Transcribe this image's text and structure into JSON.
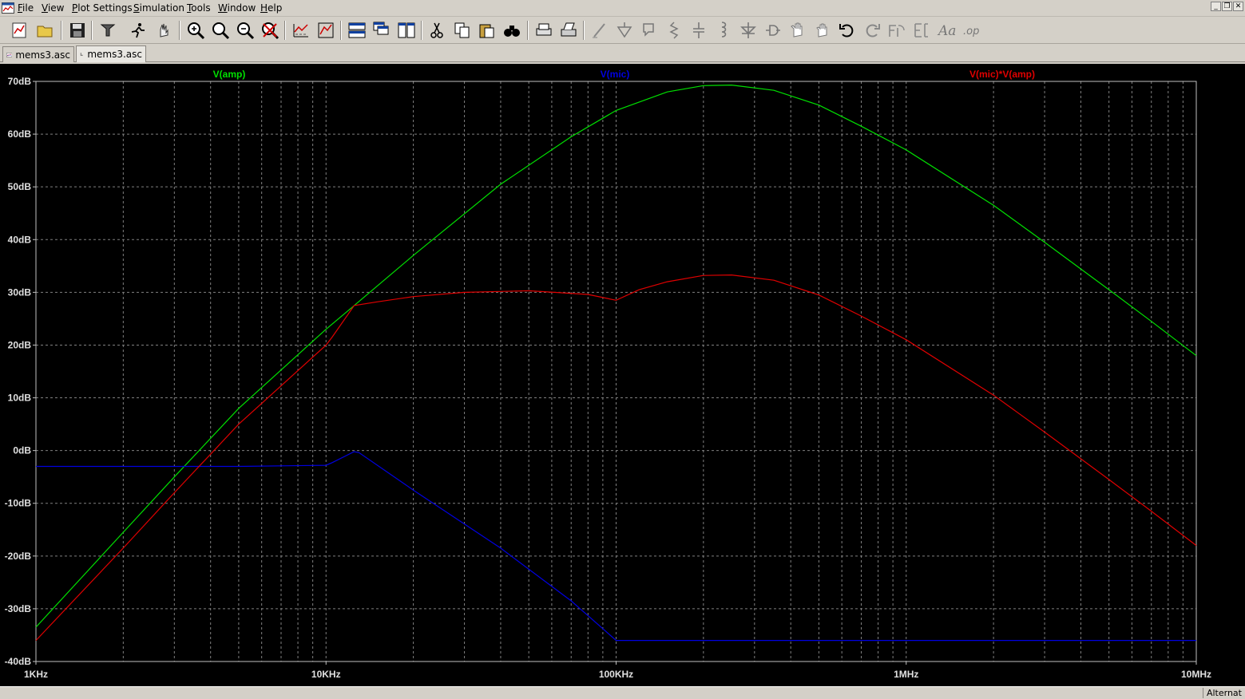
{
  "menubar": {
    "items": [
      "File",
      "View",
      "Plot Settings",
      "Simulation",
      "Tools",
      "Window",
      "Help"
    ]
  },
  "toolbar": {
    "icons": [
      "new-schematic-icon",
      "open-folder-icon",
      "save-icon",
      "control-panel-icon",
      "run-icon",
      "halt-icon",
      "zoom-in-icon",
      "zoom-full-icon",
      "zoom-out-icon",
      "zoom-cancel-icon",
      "autorange-icon",
      "plot-settings-icon",
      "tile-horizontal-icon",
      "cascade-icon",
      "tile-vertical-icon",
      "cut-icon",
      "copy-icon",
      "paste-icon",
      "find-icon",
      "print-icon",
      "print-setup-icon",
      "wire-icon",
      "ground-icon",
      "label-icon",
      "resistor-icon",
      "capacitor-icon",
      "inductor-icon",
      "diode-icon",
      "component-icon",
      "move-icon",
      "drag-icon",
      "undo-icon",
      "redo-icon",
      "rotate-icon",
      "mirror-icon",
      "text-icon",
      "spice-directive-icon"
    ]
  },
  "tabs": [
    {
      "label": "mems3.asc",
      "active": false,
      "icon": "waveform-icon"
    },
    {
      "label": "mems3.asc",
      "active": true,
      "icon": "schematic-icon"
    }
  ],
  "status": {
    "text": "Alternat"
  },
  "colors": {
    "amp": "#00e000",
    "mic": "#0000e0",
    "product": "#e00000",
    "background": "#000000",
    "grid": "#808080"
  },
  "chart_data": {
    "type": "line",
    "xscale": "log",
    "xlim": [
      1000,
      10000000
    ],
    "ylim": [
      -40,
      70
    ],
    "grid": true,
    "legend_position": "top",
    "x_ticks": [
      {
        "v": 1000,
        "label": "1KHz"
      },
      {
        "v": 10000,
        "label": "10KHz"
      },
      {
        "v": 100000,
        "label": "100KHz"
      },
      {
        "v": 1000000,
        "label": "1MHz"
      },
      {
        "v": 10000000,
        "label": "10MHz"
      }
    ],
    "y_ticks": [
      {
        "v": 70,
        "label": "70dB"
      },
      {
        "v": 60,
        "label": "60dB"
      },
      {
        "v": 50,
        "label": "50dB"
      },
      {
        "v": 40,
        "label": "40dB"
      },
      {
        "v": 30,
        "label": "30dB"
      },
      {
        "v": 20,
        "label": "20dB"
      },
      {
        "v": 10,
        "label": "10dB"
      },
      {
        "v": 0,
        "label": "0dB"
      },
      {
        "v": -10,
        "label": "-10dB"
      },
      {
        "v": -20,
        "label": "-20dB"
      },
      {
        "v": -30,
        "label": "-30dB"
      },
      {
        "v": -40,
        "label": "-40dB"
      }
    ],
    "series": [
      {
        "name": "V(amp)",
        "color": "#00e000",
        "points": [
          [
            1000,
            -33.5
          ],
          [
            2000,
            -15.5
          ],
          [
            3000,
            -5
          ],
          [
            5000,
            8
          ],
          [
            10000,
            23
          ],
          [
            12500,
            27.5
          ],
          [
            20000,
            37
          ],
          [
            40000,
            50.5
          ],
          [
            70000,
            59.5
          ],
          [
            100000,
            64.5
          ],
          [
            150000,
            68
          ],
          [
            200000,
            69.2
          ],
          [
            250000,
            69.3
          ],
          [
            350000,
            68.3
          ],
          [
            500000,
            65.5
          ],
          [
            700000,
            61.5
          ],
          [
            1000000,
            57
          ],
          [
            2000000,
            46.5
          ],
          [
            3000000,
            39.5
          ],
          [
            5000000,
            30.5
          ],
          [
            7000000,
            24.5
          ],
          [
            10000000,
            18
          ]
        ]
      },
      {
        "name": "V(mic)",
        "color": "#0000e0",
        "points": [
          [
            1000,
            -3
          ],
          [
            5000,
            -3
          ],
          [
            10000,
            -2.8
          ],
          [
            10500,
            -2.3
          ],
          [
            12500,
            -0.2
          ],
          [
            13000,
            -0.4
          ],
          [
            20000,
            -7.5
          ],
          [
            40000,
            -18.5
          ],
          [
            70000,
            -28.5
          ],
          [
            100000,
            -36
          ],
          [
            200000,
            -36
          ],
          [
            1000000,
            -36
          ],
          [
            10000000,
            -36
          ]
        ]
      },
      {
        "name": "V(mic)*V(amp)",
        "color": "#e00000",
        "points": [
          [
            1000,
            -36
          ],
          [
            2000,
            -18.5
          ],
          [
            3000,
            -8
          ],
          [
            5000,
            5
          ],
          [
            10000,
            20
          ],
          [
            10500,
            21.5
          ],
          [
            12500,
            27.5
          ],
          [
            15000,
            28.2
          ],
          [
            20000,
            29.2
          ],
          [
            30000,
            30
          ],
          [
            50000,
            30.3
          ],
          [
            80000,
            29.6
          ],
          [
            100000,
            28.5
          ],
          [
            120000,
            30.5
          ],
          [
            150000,
            32
          ],
          [
            200000,
            33.2
          ],
          [
            250000,
            33.3
          ],
          [
            350000,
            32.3
          ],
          [
            500000,
            29.5
          ],
          [
            700000,
            25.5
          ],
          [
            1000000,
            21
          ],
          [
            2000000,
            10.5
          ],
          [
            3000000,
            3.5
          ],
          [
            5000000,
            -5.5
          ],
          [
            7000000,
            -11.5
          ],
          [
            10000000,
            -18
          ]
        ]
      }
    ]
  }
}
